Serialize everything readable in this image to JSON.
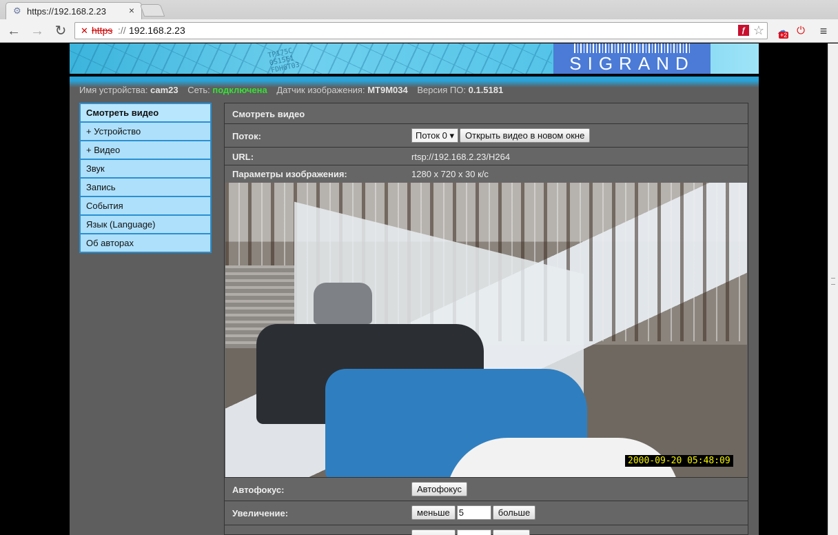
{
  "browser": {
    "tab_title": "https://192.168.2.23",
    "tab_close": "×",
    "url_protocol": "https",
    "url_separator": "://",
    "url_host": "192.168.2.23",
    "ext_badge": "+2"
  },
  "info": {
    "device_label": "Имя устройства:",
    "device_value": "cam23",
    "network_label": "Сеть:",
    "network_value": "подключена",
    "sensor_label": "Датчик изображения:",
    "sensor_value": "MT9M034",
    "version_label": "Версия ПО:",
    "version_value": "0.1.5181"
  },
  "logo": {
    "brand": "SIGRAND"
  },
  "sidebar": {
    "items": [
      {
        "label": "Смотреть видео"
      },
      {
        "label": "+ Устройство"
      },
      {
        "label": "+ Видео"
      },
      {
        "label": "Звук"
      },
      {
        "label": "Запись"
      },
      {
        "label": "События"
      },
      {
        "label": "Язык (Language)"
      },
      {
        "label": "Об авторах"
      }
    ]
  },
  "panel": {
    "title": "Смотреть видео",
    "stream_label": "Поток:",
    "stream_value": "Поток 0",
    "open_new_window": "Открыть видео в новом окне",
    "url_label": "URL:",
    "url_value": "rtsp://192.168.2.23/H264",
    "params_label": "Параметры изображения:",
    "params_value": "1280 x 720 x 30 к/с",
    "timestamp": "2000-09-20 05:48:09",
    "autofocus_label": "Автофокус:",
    "autofocus_button": "Автофокус",
    "zoom_label": "Увеличение:",
    "zoom_less": "меньше",
    "zoom_value": "5",
    "zoom_more": "больше"
  }
}
